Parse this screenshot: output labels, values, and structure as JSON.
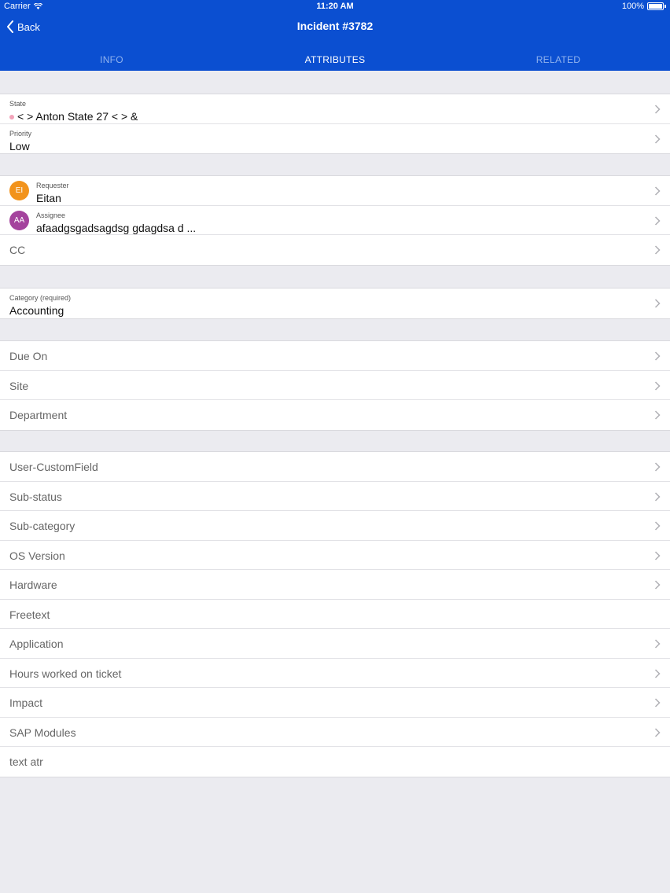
{
  "status_bar": {
    "carrier": "Carrier",
    "time": "11:20 AM",
    "battery": "100%"
  },
  "nav": {
    "back_label": "Back",
    "title": "Incident #3782"
  },
  "tabs": [
    {
      "label": "INFO",
      "active": false
    },
    {
      "label": "ATTRIBUTES",
      "active": true
    },
    {
      "label": "RELATED",
      "active": false
    }
  ],
  "colors": {
    "header": "#0b4fd1",
    "state_dot": "#f2a3b9",
    "requester_avatar": "#f2931c",
    "assignee_avatar": "#a4439d"
  },
  "state_group": {
    "state": {
      "label": "State",
      "value": "< > Anton State 27 < > &"
    },
    "priority": {
      "label": "Priority",
      "value": "Low"
    }
  },
  "people_group": {
    "requester": {
      "label": "Requester",
      "value": "Eitan",
      "initials": "EI"
    },
    "assignee": {
      "label": "Assignee",
      "value": "afaadgsgadsagdsg gdagdsa d ...",
      "initials": "AA"
    },
    "cc": {
      "label": "CC"
    }
  },
  "category_group": {
    "label": "Category (required)",
    "value": "Accounting"
  },
  "dates_group": {
    "due_on": "Due On",
    "site": "Site",
    "department": "Department"
  },
  "custom_fields": [
    {
      "label": "User-CustomField",
      "chevron": true
    },
    {
      "label": "Sub-status",
      "chevron": true
    },
    {
      "label": "Sub-category",
      "chevron": true
    },
    {
      "label": "OS Version",
      "chevron": true
    },
    {
      "label": "Hardware",
      "chevron": true
    },
    {
      "label": "Freetext",
      "chevron": false
    },
    {
      "label": "Application",
      "chevron": true
    },
    {
      "label": "Hours worked on ticket",
      "chevron": true
    },
    {
      "label": "Impact",
      "chevron": true
    },
    {
      "label": "SAP Modules",
      "chevron": true
    },
    {
      "label": "text atr",
      "chevron": false
    }
  ]
}
